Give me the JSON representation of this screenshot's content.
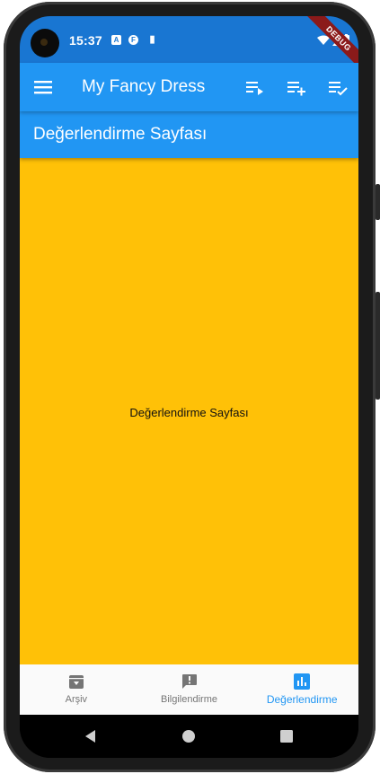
{
  "status_bar": {
    "time": "15:37",
    "debug_banner": "DEBUG",
    "notification_icons": [
      "A",
      "F",
      "▮"
    ]
  },
  "app_bar": {
    "title": "My Fancy Dress",
    "menu_icon": "menu-icon",
    "actions": [
      "playlist-play-icon",
      "playlist-add-icon",
      "playlist-add-check-icon"
    ]
  },
  "sub_header": {
    "title": "Değerlendirme Sayfası"
  },
  "content": {
    "text": "Değerlendirme Sayfası",
    "background": "#ffc107"
  },
  "bottom_nav": {
    "items": [
      {
        "label": "Arşiv",
        "icon": "archive-icon",
        "active": false
      },
      {
        "label": "Bilgilendirme",
        "icon": "feedback-icon",
        "active": false
      },
      {
        "label": "Değerlendirme",
        "icon": "bar-chart-icon",
        "active": true
      }
    ]
  },
  "colors": {
    "primary": "#2196f3",
    "status_bar": "#1976d2",
    "accent_content": "#ffc107"
  }
}
